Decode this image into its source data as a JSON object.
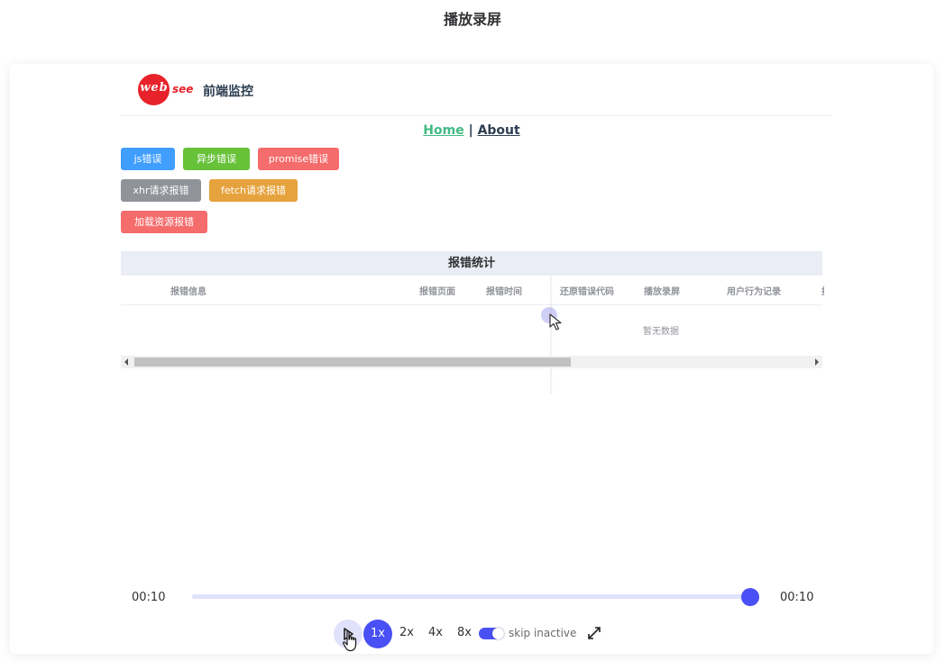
{
  "page": {
    "title": "播放录屏"
  },
  "app": {
    "logo": {
      "web_text": "web",
      "see_text": "see"
    },
    "title": "前端监控",
    "nav": {
      "home": "Home",
      "separator": "|",
      "about": "About"
    },
    "buttons": {
      "js_error": "js错误",
      "async_error": "异步错误",
      "promise_error": "promise错误",
      "xhr_error": "xhr请求报错",
      "fetch_error": "fetch请求报错",
      "resource_error": "加载资源报错"
    },
    "table": {
      "title": "报错统计",
      "columns": [
        "报错信息",
        "报错页面",
        "报错时间",
        "还原错误代码",
        "播放录屏",
        "用户行为记录",
        "报"
      ],
      "empty_text": "暂无数据"
    }
  },
  "player": {
    "current_time": "00:10",
    "total_time": "00:10",
    "progress": 1.0,
    "speeds": [
      "1x",
      "2x",
      "4x",
      "8x"
    ],
    "active_speed": "1x",
    "skip_inactive": {
      "label": "skip inactive",
      "enabled": true
    }
  },
  "colors": {
    "accent": "#4950f6",
    "track": "#e0e1fa",
    "nav_home": "#42b983",
    "btn_blue": "#409eff",
    "btn_green": "#67c23a",
    "btn_red": "#f56c6c",
    "btn_gray": "#909399",
    "btn_orange": "#e6a23c",
    "logo_red": "#e8222a"
  },
  "icons": [
    "play-icon",
    "fullscreen-icon",
    "mouse-pointer-icon",
    "hand-pointer-icon"
  ]
}
